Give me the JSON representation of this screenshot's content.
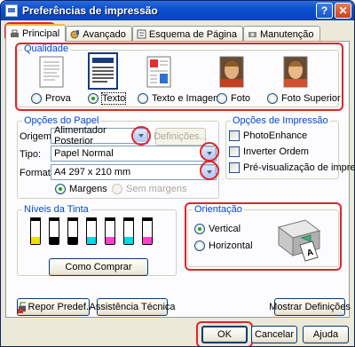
{
  "window": {
    "title": "Preferências de impressão",
    "help_button": "?",
    "close_button": "✕"
  },
  "tabs": [
    {
      "label": "Principal",
      "icon": "printer-icon",
      "active": true
    },
    {
      "label": "Avançado",
      "icon": "settings-icon",
      "active": false
    },
    {
      "label": "Esquema de Página",
      "icon": "page-layout-icon",
      "active": false
    },
    {
      "label": "Manutenção",
      "icon": "maintenance-icon",
      "active": false
    }
  ],
  "quality": {
    "group_label": "Qualidade",
    "options": [
      {
        "label": "Prova",
        "selected": false
      },
      {
        "label": "Texto",
        "selected": true
      },
      {
        "label": "Texto e Imagem",
        "selected": false
      },
      {
        "label": "Foto",
        "selected": false
      },
      {
        "label": "Foto Superior",
        "selected": false
      }
    ]
  },
  "paper_options": {
    "group_label": "Opções do Papel",
    "source_label": "Origem:",
    "source_value": "Alimentador Posterior",
    "settings_button": "Definições...",
    "type_label": "Tipo:",
    "type_value": "Papel Normal",
    "format_label": "Formato:",
    "format_value": "A4 297 x 210 mm",
    "margins_label": "Margens",
    "margins_selected": true,
    "no_margins_label": "Sem margens",
    "no_margins_enabled": false
  },
  "print_options": {
    "group_label": "Opções de Impressão",
    "checkboxes": [
      {
        "label": "PhotoEnhance",
        "checked": false
      },
      {
        "label": "Inverter Ordem",
        "checked": false
      },
      {
        "label": "Pré-visualização de impressão",
        "checked": false
      }
    ]
  },
  "ink_levels": {
    "group_label": "Níveis da Tinta",
    "buy_button": "Como Comprar",
    "cartridges": [
      {
        "color": "#f0e000",
        "level": 0.32
      },
      {
        "color": "#000000",
        "level": 0.32
      },
      {
        "color": "#000000",
        "level": 0.32
      },
      {
        "color": "#00d8ec",
        "level": 0.32
      },
      {
        "color": "#ff40d0",
        "level": 0.32
      },
      {
        "color": "#00d8ec",
        "level": 0.32
      },
      {
        "color": "#ff40d0",
        "level": 0.32
      }
    ]
  },
  "orientation": {
    "group_label": "Orientação",
    "vertical_label": "Vertical",
    "vertical_selected": true,
    "horizontal_label": "Horizontal"
  },
  "bottom": {
    "reset_button": "Repor Predef.",
    "tech_support_button": "Assistência Técnica",
    "show_settings_button": "Mostrar Definições"
  },
  "footer": {
    "ok_button": "OK",
    "cancel_button": "Cancelar",
    "help_button": "Ajuda"
  },
  "colors": {
    "highlight_red": "#e2232a",
    "xp_title_blue": "#0a4fd1",
    "group_label_blue": "#0046d5"
  }
}
